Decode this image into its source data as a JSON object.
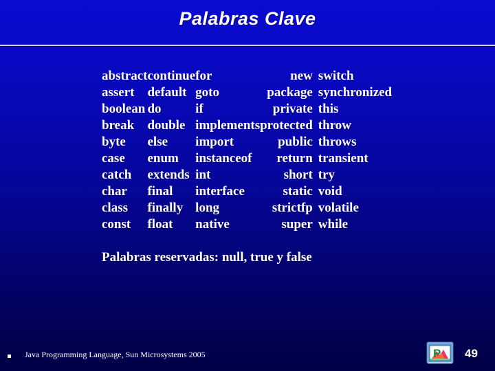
{
  "slide": {
    "title": "Palabras Clave",
    "background_top_color": "#0b0bd2",
    "background_bottom_color": "#000046",
    "text_color": "#ffffff",
    "rule_color": "#d8d8d8"
  },
  "keywords": {
    "columns": 5,
    "rows": [
      [
        "abstract",
        "continue",
        "for",
        "new",
        "switch"
      ],
      [
        "assert",
        "default",
        "goto",
        "package",
        "synchronized"
      ],
      [
        "boolean",
        "do",
        "if",
        "private",
        "this"
      ],
      [
        "break",
        "double",
        "implements",
        "protected",
        "throw"
      ],
      [
        "byte",
        "else",
        "import",
        "public",
        "throws"
      ],
      [
        "case",
        "enum",
        "instanceof",
        "return",
        "transient"
      ],
      [
        "catch",
        "extends",
        "int",
        "short",
        "try"
      ],
      [
        "char",
        "final",
        "interface",
        "static",
        "void"
      ],
      [
        "class",
        "finally",
        "long",
        "strictfp",
        "volatile"
      ],
      [
        "const",
        "float",
        "native",
        "super",
        "while"
      ]
    ]
  },
  "reserved_line": "Palabras reservadas: null, true y false",
  "footer": {
    "bullet": "square-bullet",
    "text": "Java Programming Language, Sun Microsystems 2005",
    "page_number": "49",
    "icon_name": "powerpoint-icon"
  }
}
